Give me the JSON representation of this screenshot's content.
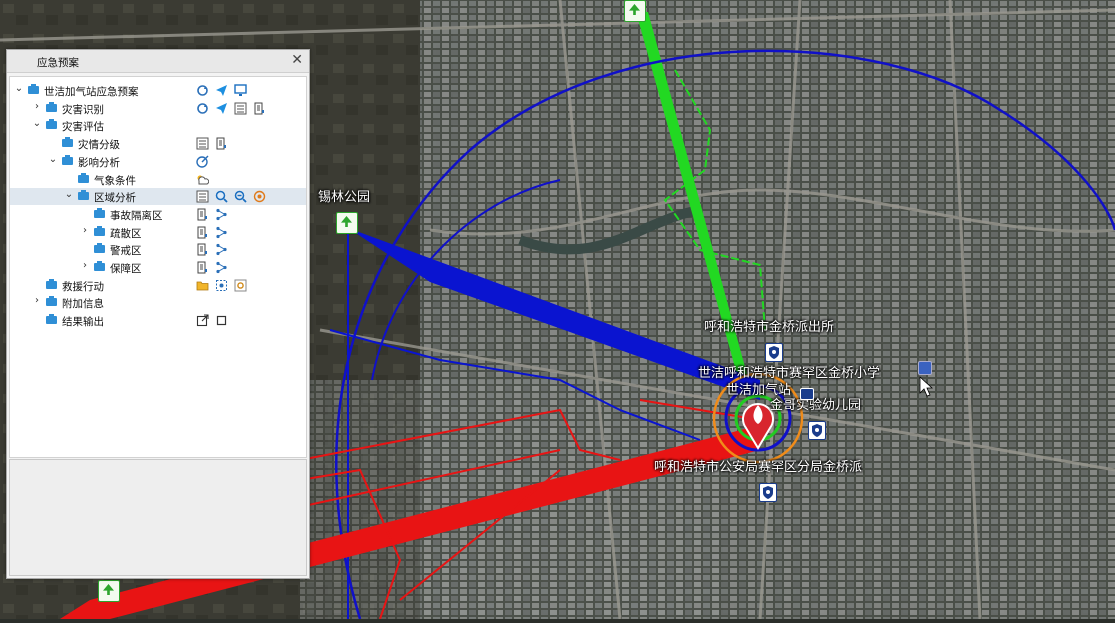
{
  "panel": {
    "title": "应急预案",
    "close_icon": "close-icon",
    "tree": [
      {
        "label": "世洁加气站应急预案",
        "toggle": "expanded",
        "level": 0,
        "tools": [
          "refresh-icon",
          "send-icon",
          "monitor-icon"
        ]
      },
      {
        "label": "灾害识别",
        "toggle": "collapsed",
        "level": 1,
        "tools": [
          "refresh-icon",
          "send-icon",
          "list-icon",
          "print-icon"
        ]
      },
      {
        "label": "灾害评估",
        "toggle": "expanded",
        "level": 1,
        "tools": []
      },
      {
        "label": "灾情分级",
        "toggle": "none",
        "level": 2,
        "tools": [
          "list-icon",
          "print-icon"
        ]
      },
      {
        "label": "影响分析",
        "toggle": "expanded",
        "level": 2,
        "tools": [
          "radius-icon"
        ]
      },
      {
        "label": "气象条件",
        "toggle": "none",
        "level": 3,
        "tools": [
          "weather-icon"
        ]
      },
      {
        "label": "区域分析",
        "toggle": "expanded",
        "level": 3,
        "tools": [
          "list-icon",
          "zoom-in-icon",
          "zoom-out-icon",
          "target-icon"
        ],
        "selected": true
      },
      {
        "label": "事故隔离区",
        "toggle": "none",
        "level": 4,
        "tools": [
          "print-icon",
          "route-icon"
        ]
      },
      {
        "label": "疏散区",
        "toggle": "collapsed",
        "level": 4,
        "tools": [
          "print-icon",
          "route-icon"
        ]
      },
      {
        "label": "警戒区",
        "toggle": "none",
        "level": 4,
        "tools": [
          "print-icon",
          "route-icon"
        ]
      },
      {
        "label": "保障区",
        "toggle": "collapsed",
        "level": 4,
        "tools": [
          "print-icon",
          "route-icon"
        ]
      },
      {
        "label": "救援行动",
        "toggle": "none",
        "level": 1,
        "tools": [
          "folder-icon",
          "select-area-icon",
          "settings-icon"
        ]
      },
      {
        "label": "附加信息",
        "toggle": "collapsed",
        "level": 1,
        "tools": []
      },
      {
        "label": "结果输出",
        "toggle": "none",
        "level": 1,
        "tools": [
          "export-icon",
          "square-icon"
        ]
      }
    ]
  },
  "map": {
    "labels": {
      "park": "锡林公园",
      "police_station": "呼和浩特市金桥派出所",
      "school": "世洁呼和浩特市赛罕区金桥小学",
      "gas_station": "世洁加气站",
      "kindergarten": "金哥实验幼儿园",
      "police_bureau": "呼和浩特市公安局赛罕区分局金桥派"
    },
    "colors": {
      "blue_plume": "#0a14d0",
      "red_plume": "#e81414",
      "green_plume": "#22d822",
      "circle": "#1010c8",
      "incident": "#d8262e"
    }
  }
}
